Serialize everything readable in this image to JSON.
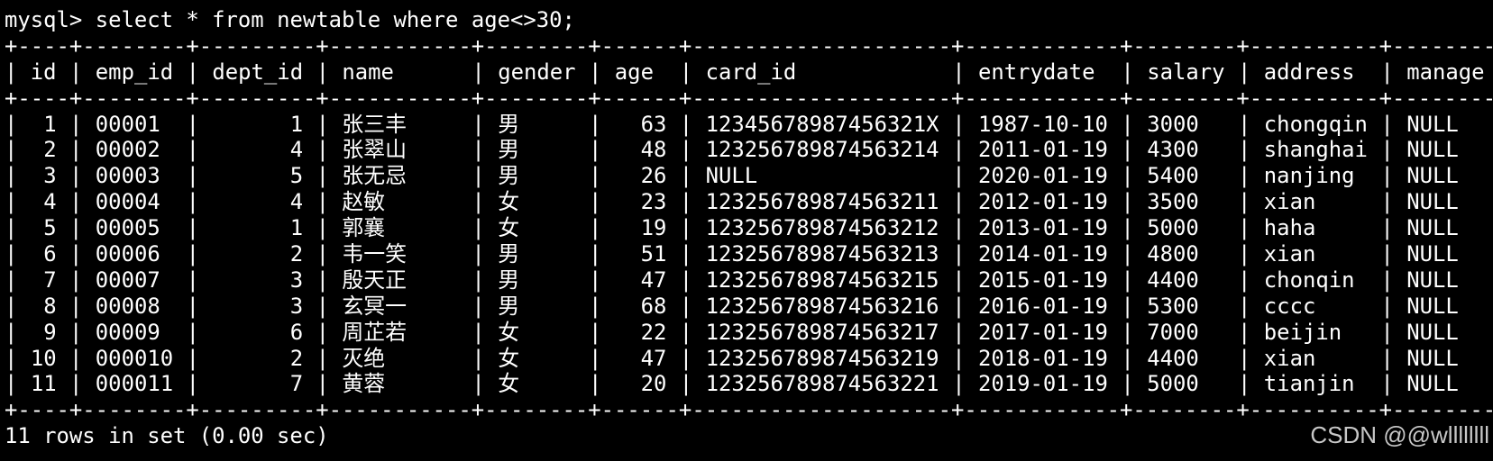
{
  "terminal": {
    "prompt": "mysql>",
    "command": "select * from newtable where age<>30;",
    "border": "+----+--------+---------+-----------+--------+------+--------------------+------------+--------+----------+--------+",
    "headers": [
      "id",
      "emp_id",
      "dept_id",
      "name",
      "gender",
      "age",
      "card_id",
      "entrydate",
      "salary",
      "address",
      "manage"
    ],
    "rows": [
      [
        "1",
        "00001",
        "1",
        "张三丰",
        "男",
        "63",
        "12345678987456321X",
        "1987-10-10",
        "3000",
        "chongqin",
        "NULL"
      ],
      [
        "2",
        "00002",
        "4",
        "张翠山",
        "男",
        "48",
        "123256789874563214",
        "2011-01-19",
        "4300",
        "shanghai",
        "NULL"
      ],
      [
        "3",
        "00003",
        "5",
        "张无忌",
        "男",
        "26",
        "NULL",
        "2020-01-19",
        "5400",
        "nanjing",
        "NULL"
      ],
      [
        "4",
        "00004",
        "4",
        "赵敏",
        "女",
        "23",
        "123256789874563211",
        "2012-01-19",
        "3500",
        "xian",
        "NULL"
      ],
      [
        "5",
        "00005",
        "1",
        "郭襄",
        "女",
        "19",
        "123256789874563212",
        "2013-01-19",
        "5000",
        "haha",
        "NULL"
      ],
      [
        "6",
        "00006",
        "2",
        "韦一笑",
        "男",
        "51",
        "123256789874563213",
        "2014-01-19",
        "4800",
        "xian",
        "NULL"
      ],
      [
        "7",
        "00007",
        "3",
        "殷天正",
        "男",
        "47",
        "123256789874563215",
        "2015-01-19",
        "4400",
        "chonqin",
        "NULL"
      ],
      [
        "8",
        "00008",
        "3",
        "玄冥一",
        "男",
        "68",
        "123256789874563216",
        "2016-01-19",
        "5300",
        "cccc",
        "NULL"
      ],
      [
        "9",
        "00009",
        "6",
        "周芷若",
        "女",
        "22",
        "123256789874563217",
        "2017-01-19",
        "7000",
        "beijin",
        "NULL"
      ],
      [
        "10",
        "000010",
        "2",
        "灭绝",
        "女",
        "47",
        "123256789874563219",
        "2018-01-19",
        "4400",
        "xian",
        "NULL"
      ],
      [
        "11",
        "000011",
        "7",
        "黄蓉",
        "女",
        "20",
        "123256789874563221",
        "2019-01-19",
        "5000",
        "tianjin",
        "NULL"
      ]
    ],
    "footer": "11 rows in set (0.00 sec)"
  },
  "watermark": "CSDN @@wllllllll",
  "colors": {
    "background": "#000000",
    "text": "#ffffff",
    "watermark": "#c8c8c8"
  }
}
